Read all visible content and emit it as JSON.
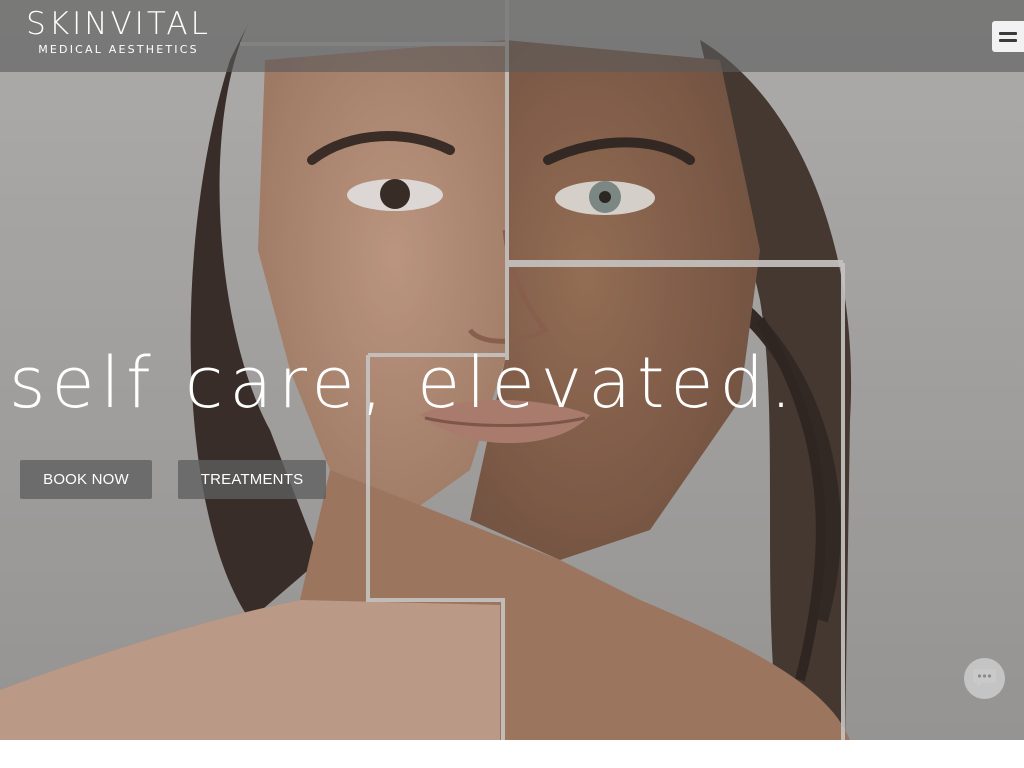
{
  "brand": {
    "name": "SKINVITAL",
    "tagline": "MEDICAL AESTHETICS"
  },
  "header": {
    "menu_icon": "hamburger-menu-icon"
  },
  "hero": {
    "headline": "self care, elevated.",
    "image_subject": "portrait-collage",
    "buttons": {
      "book_now": "BOOK NOW",
      "treatments": "TREATMENTS"
    }
  },
  "chat": {
    "icon": "chat-bubble-icon"
  },
  "colors": {
    "overlay": "#5a5a5a",
    "button_bg": "#5f5f5f",
    "text": "#ffffff",
    "menu_button_bg": "#f2f2f2"
  }
}
